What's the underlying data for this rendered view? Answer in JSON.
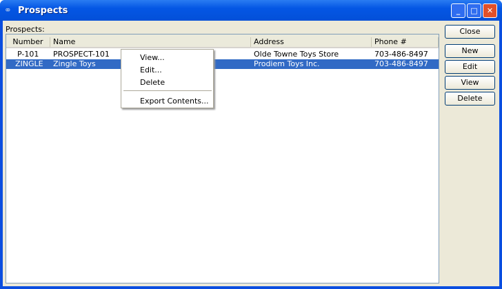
{
  "window": {
    "title": "Prospects",
    "icon": "prospects-icon"
  },
  "list_label": "Prospects:",
  "columns": [
    "Number",
    "Name",
    "Address",
    "Phone #"
  ],
  "rows": [
    {
      "number": "P-101",
      "name": "PROSPECT-101",
      "address": "Olde Towne Toys Store",
      "phone": "703-486-8497"
    },
    {
      "number": "ZINGLE",
      "name": "Zingle Toys",
      "address": "Prodiem Toys Inc.",
      "phone": "703-486-8497"
    }
  ],
  "buttons": {
    "close": "Close",
    "new": "New",
    "edit": "Edit",
    "view": "View",
    "delete": "Delete"
  },
  "context_menu": [
    "View...",
    "Edit...",
    "Delete",
    "Export Contents..."
  ]
}
